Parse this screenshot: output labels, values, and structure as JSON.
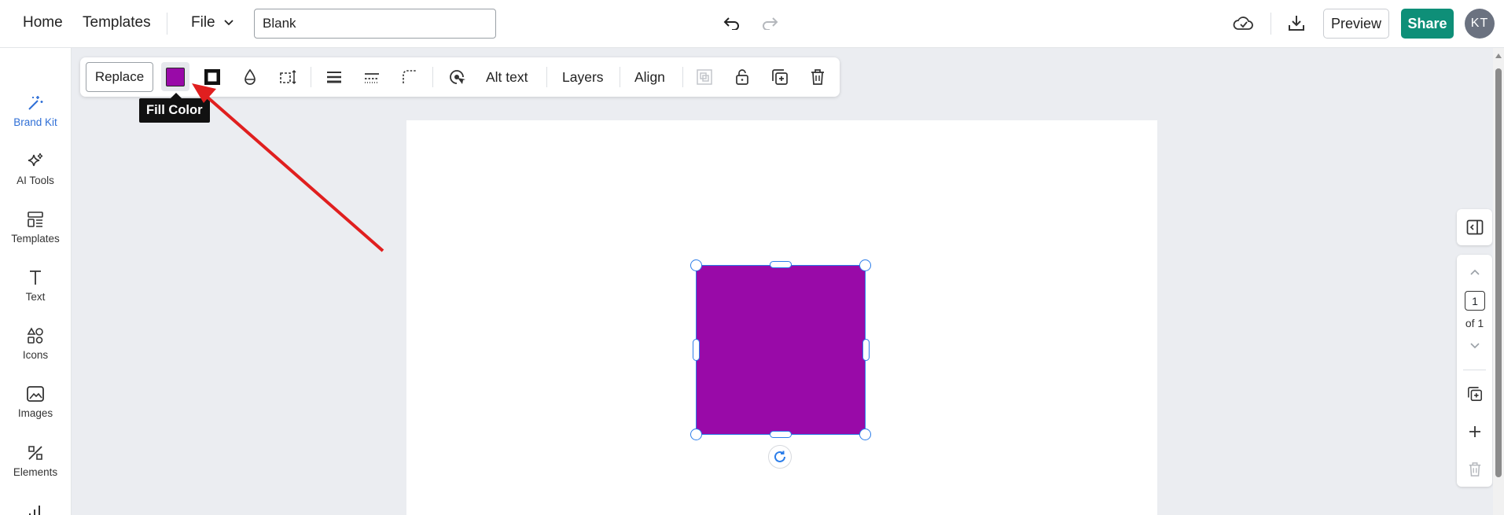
{
  "header": {
    "home_label": "Home",
    "templates_label": "Templates",
    "file_label": "File",
    "doc_title": "Blank",
    "preview_label": "Preview",
    "share_label": "Share",
    "avatar_initials": "KT",
    "share_color": "#0e8f78"
  },
  "sidebar": {
    "items": [
      {
        "label": "Brand Kit",
        "icon": "magic-wand-icon",
        "active": true
      },
      {
        "label": "AI Tools",
        "icon": "sparkles-icon"
      },
      {
        "label": "Templates",
        "icon": "templates-icon"
      },
      {
        "label": "Text",
        "icon": "text-icon"
      },
      {
        "label": "Icons",
        "icon": "shapes-icon"
      },
      {
        "label": "Images",
        "icon": "image-icon"
      },
      {
        "label": "Elements",
        "icon": "elements-icon"
      }
    ]
  },
  "toolbar": {
    "replace_label": "Replace",
    "alt_text_label": "Alt text",
    "layers_label": "Layers",
    "align_label": "Align",
    "fill_color": "#990aa8",
    "tooltip": "Fill Color"
  },
  "canvas": {
    "shape_color": "#990aa8",
    "selection_color": "#2b7de9"
  },
  "pager": {
    "current_page": "1",
    "of_label": "of 1"
  }
}
